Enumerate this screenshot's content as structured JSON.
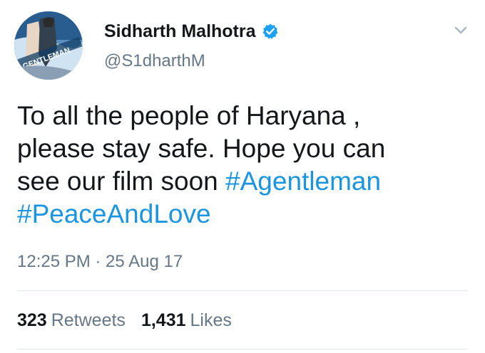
{
  "user": {
    "display_name": "Sidharth Malhotra",
    "handle": "@S1dharthM",
    "verified": true,
    "avatar_text": "GENTLEMAN"
  },
  "tweet": {
    "line1": "To all the people of Haryana ,",
    "line2": "please stay safe. Hope you can",
    "line3_text": "see our film soon ",
    "hashtag1": "#Agentleman",
    "hashtag2": "#PeaceAndLove",
    "timestamp": "12:25 PM · 25 Aug 17"
  },
  "stats": {
    "retweets_count": "323",
    "retweets_label": "Retweets",
    "likes_count": "1,431",
    "likes_label": "Likes"
  },
  "colors": {
    "link": "#1b95e0",
    "verified_badge": "#1da1f2",
    "secondary_text": "#657786",
    "primary_text": "#14171a"
  },
  "icons": {
    "verified": "verified-badge-icon",
    "menu": "chevron-down-icon"
  }
}
